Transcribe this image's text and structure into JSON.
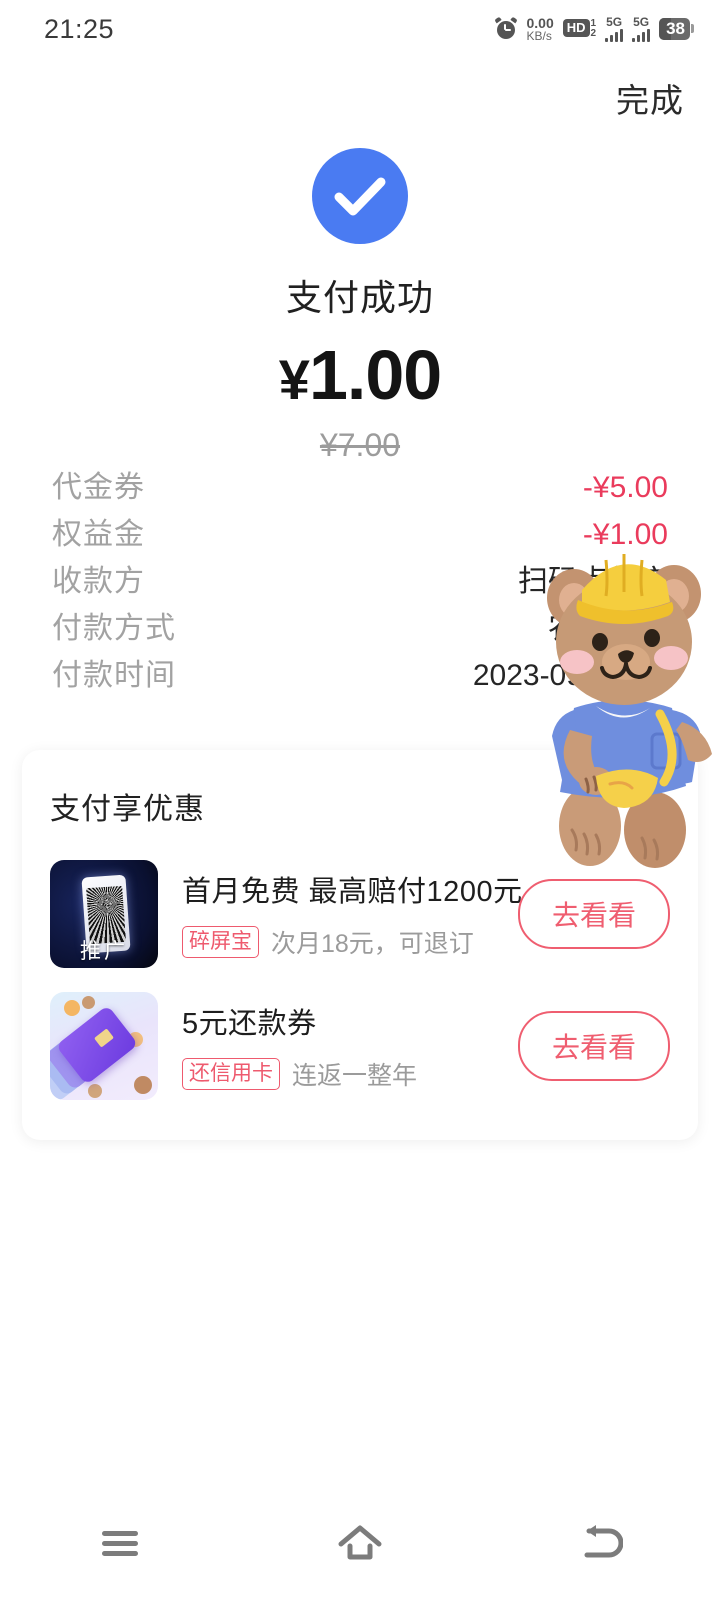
{
  "statusbar": {
    "clock": "21:25",
    "alarm_icon": "alarm-clock-icon",
    "network_speed_value": "0.00",
    "network_speed_unit": "KB/s",
    "hd_label": "HD",
    "hd_sup": "1",
    "hd_sub": "2",
    "sim1_label": "5G",
    "sim2_label": "5G",
    "battery_level": "38"
  },
  "topbar": {
    "done_label": "完成"
  },
  "success": {
    "check_icon": "check-circle-icon",
    "title": "支付成功",
    "currency_symbol": "¥",
    "amount": "1.00",
    "original_amount": "¥7.00",
    "accent_color": "#4a7bf2"
  },
  "details": {
    "rows": [
      {
        "label": "代金券",
        "value": "-¥5.00",
        "negative": true
      },
      {
        "label": "权益金",
        "value": "-¥1.00",
        "negative": true
      },
      {
        "label": "收款方",
        "value": "扫码点单店",
        "negative": false
      },
      {
        "label": "付款方式",
        "value": "农业银行",
        "negative": false
      },
      {
        "label": "付款时间",
        "value": "2023-09-06 21",
        "negative": false
      }
    ],
    "negative_color": "#ea3b5c"
  },
  "mascot": {
    "name": "bear-mascot",
    "hat_color": "#f5ce3e",
    "body_color": "#c39370",
    "shirt_color": "#6f8ede",
    "bag_color": "#f5d04a"
  },
  "promo": {
    "title": "支付享优惠",
    "accent_color": "#ef5e70",
    "items": [
      {
        "thumb_name": "broken-phone-screen-image",
        "thumb_tag": "推广",
        "headline": "首月免费  最高赔付1200元",
        "badge": "碎屏宝",
        "desc": "次月18元，可退订",
        "cta": "去看看"
      },
      {
        "thumb_name": "credit-card-stack-image",
        "thumb_tag": "",
        "headline": "5元还款券",
        "badge": "还信用卡",
        "desc": "连返一整年",
        "cta": "去看看"
      }
    ]
  },
  "navbar": {
    "recents_label": "recents-icon",
    "home_label": "home-icon",
    "back_label": "back-icon"
  }
}
